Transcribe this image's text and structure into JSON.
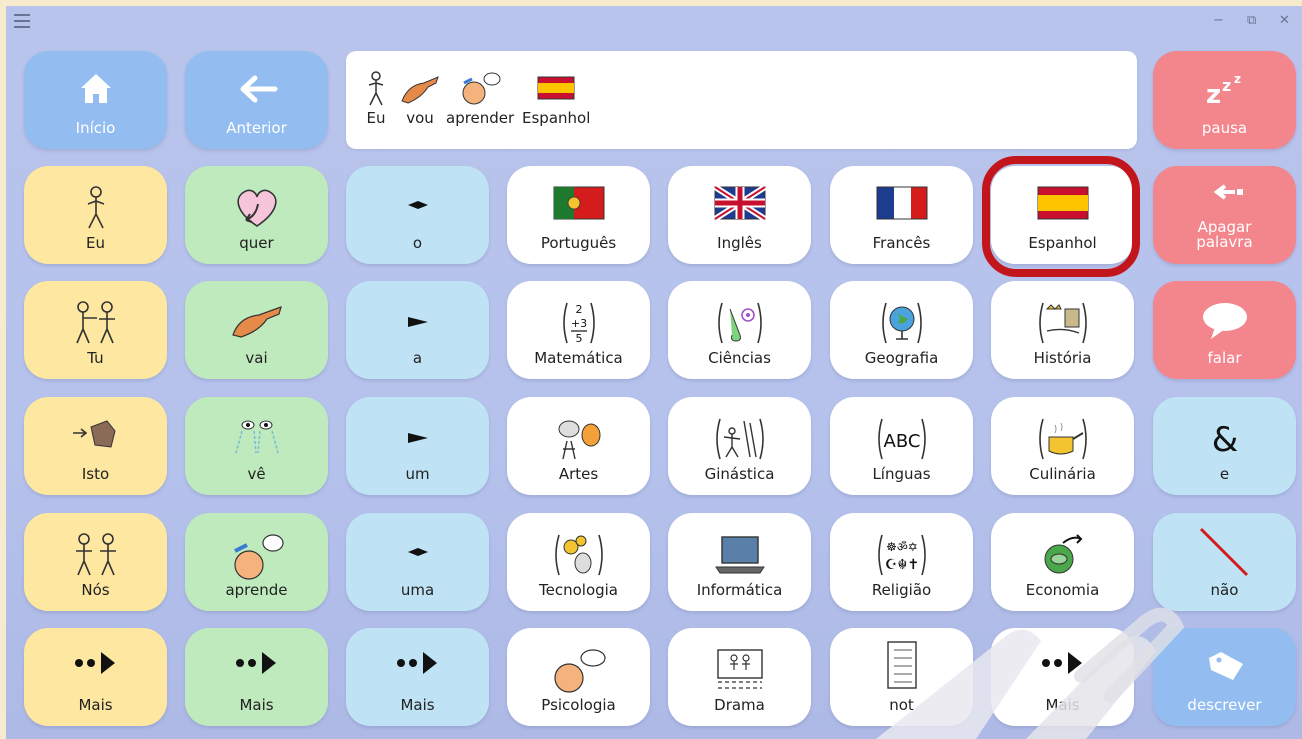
{
  "titlebar": {
    "menu_icon": "hamburger-icon",
    "minimize": "−",
    "restore": "⧉",
    "close": "✕"
  },
  "nav": {
    "home_label": "Início",
    "back_label": "Anterior",
    "pause_label": "pausa"
  },
  "sentence": {
    "words": [
      "Eu",
      "vou",
      "aprender",
      "Espanhol"
    ]
  },
  "grid": {
    "col1": [
      "Eu",
      "Tu",
      "Isto",
      "Nós",
      "Mais"
    ],
    "col2": [
      "quer",
      "vai",
      "vê",
      "aprende",
      "Mais"
    ],
    "col3": [
      "o",
      "a",
      "um",
      "uma",
      "Mais"
    ],
    "row1": [
      "Português",
      "Inglês",
      "Francês",
      "Espanhol"
    ],
    "row2": [
      "Matemática",
      "Ciências",
      "Geografia",
      "História"
    ],
    "row3": [
      "Artes",
      "Ginástica",
      "Línguas",
      "Culinária"
    ],
    "row4": [
      "Tecnologia",
      "Informática",
      "Religião",
      "Economia"
    ],
    "row5": [
      "Psicologia",
      "Drama",
      "not",
      "Mais"
    ],
    "side": [
      "Apagar palavra",
      "falar",
      "e",
      "não",
      "descrever"
    ]
  },
  "highlighted": "Espanhol",
  "colors": {
    "yellow": "#fde7a1",
    "green": "#bfeabd",
    "blue": "#bfe2f4",
    "red": "#f3858c",
    "nav_blue": "#93bdf0",
    "highlight_ring": "#c2161c"
  }
}
